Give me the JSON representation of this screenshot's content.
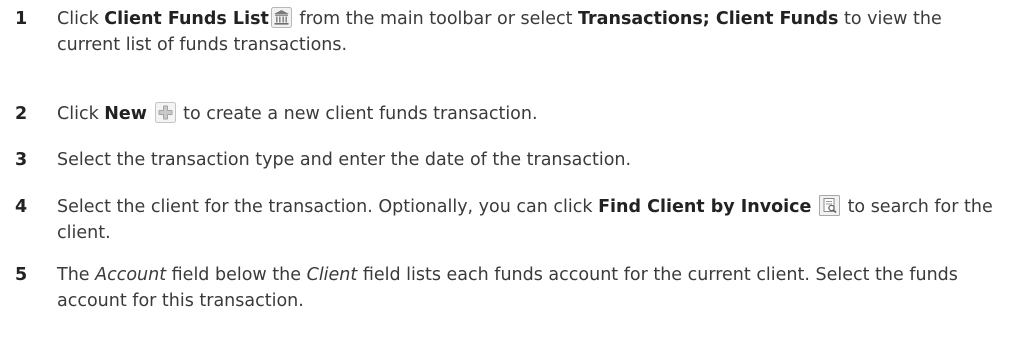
{
  "steps": [
    {
      "number": "1",
      "text_a": "Click ",
      "bold_a": "Client Funds List",
      "text_b": " from the main toolbar or select ",
      "bold_b": "Transactions; Client Funds",
      "text_c": " to view the current list of funds transactions.",
      "icon": "bank-building-icon"
    },
    {
      "number": "2",
      "text_a": "Click ",
      "bold_a": "New",
      "text_b": " to create a new client funds transaction.",
      "icon": "plus-icon"
    },
    {
      "number": "3",
      "text_a": "Select the transaction type and enter the date of the transaction."
    },
    {
      "number": "4",
      "text_a": "Select the client for the transaction. Optionally, you can click ",
      "bold_a": "Find Client by Invoice",
      "text_b": " to search for the client.",
      "icon": "find-invoice-icon"
    },
    {
      "number": "5",
      "text_a": "The ",
      "italic_a": "Account",
      "text_b": " field below the ",
      "italic_b": "Client",
      "text_c": " field lists each funds account for the current client. Select the funds account for this transaction."
    }
  ]
}
